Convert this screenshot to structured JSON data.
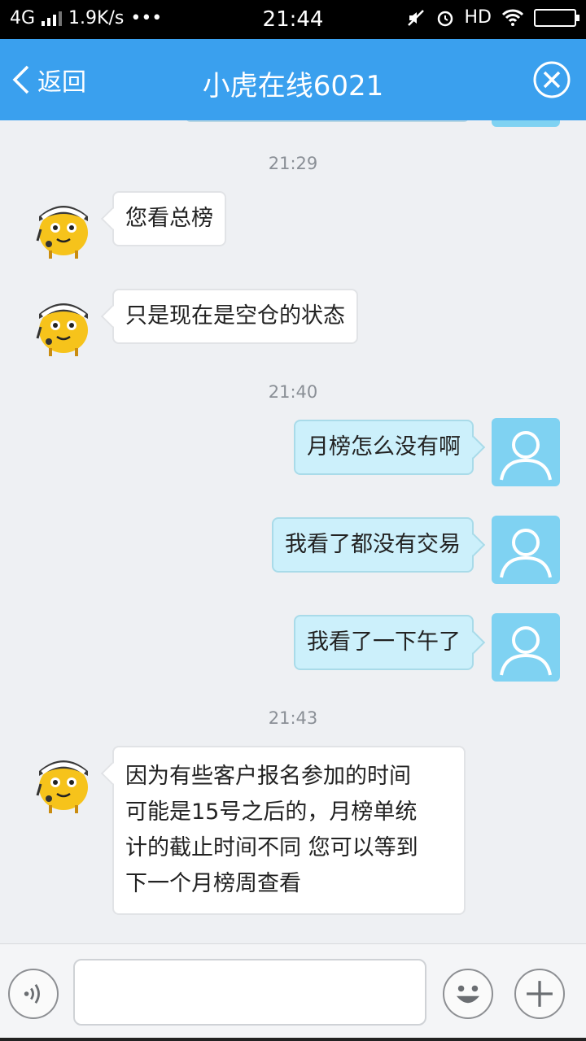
{
  "status_bar": {
    "network": "4G",
    "speed": "1.9K/s",
    "dots": "•••",
    "time": "21:44",
    "hd": "HD"
  },
  "nav": {
    "back_label": "返回",
    "title": "小虎在线6021"
  },
  "messages": [
    {
      "type": "time",
      "text": "21:29"
    },
    {
      "type": "in",
      "text": "您看总榜"
    },
    {
      "type": "in",
      "text": "只是现在是空仓的状态"
    },
    {
      "type": "time",
      "text": "21:40"
    },
    {
      "type": "out",
      "text": "月榜怎么没有啊"
    },
    {
      "type": "out",
      "text": "我看了都没有交易"
    },
    {
      "type": "out",
      "text": "我看了一下午了"
    },
    {
      "type": "time",
      "text": "21:43"
    },
    {
      "type": "in",
      "lines": [
        "因为有些客户报名参加的时间",
        "可能是15号之后的，月榜单统",
        "计的截止时间不同 您可以等到",
        "下一个月榜周查看"
      ]
    }
  ],
  "input": {
    "value": "",
    "placeholder": ""
  },
  "colors": {
    "nav_bg": "#3aa0ee",
    "bubble_out": "#ccf0fb",
    "bubble_in": "#ffffff",
    "user_avatar": "#7fd2f2"
  },
  "icons": {
    "back": "chevron-left-icon",
    "close": "circle-x-icon",
    "voice": "voice-wave-icon",
    "emoji": "smiley-icon",
    "plus": "plus-icon",
    "user_avatar": "user-silhouette-icon",
    "agent_avatar": "tiger-mascot-icon"
  }
}
